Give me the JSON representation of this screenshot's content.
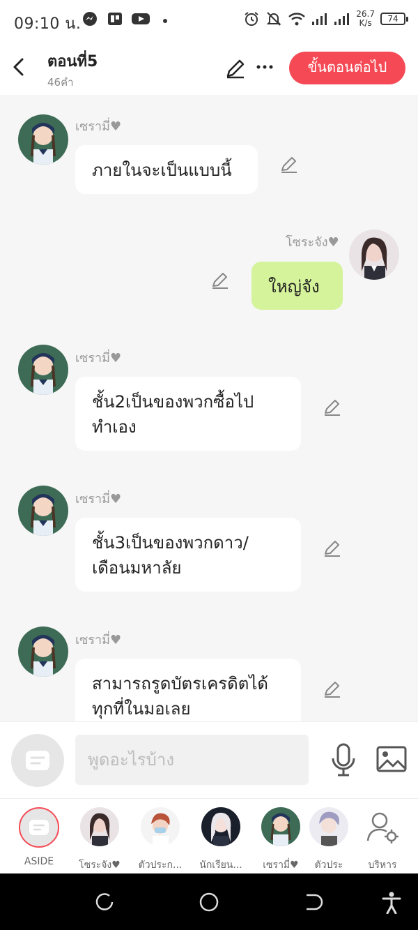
{
  "status_bar": {
    "time": "09:10 น.",
    "net_speed_value": "26.7",
    "net_speed_unit": "K/s",
    "battery": "74"
  },
  "header": {
    "title": "ตอนที่5",
    "word_count": "46คำ",
    "next_button": "ขั้นตอนต่อไป"
  },
  "messages": [
    {
      "sender": "เซรามี่♥",
      "text_lines": [
        "ภายในจะเป็นแบบนี้"
      ],
      "side": "left"
    },
    {
      "sender": "โซระจัง♥",
      "text_lines": [
        "ใหญ่จัง"
      ],
      "side": "right"
    },
    {
      "sender": "เซรามี่♥",
      "text_lines": [
        "ชั้น2เป็นของพวกซื้อไป",
        "ทำเอง"
      ],
      "side": "left"
    },
    {
      "sender": "เซรามี่♥",
      "text_lines": [
        "ชั้น3เป็นของพวกดาว/",
        "เดือนมหาลัย"
      ],
      "side": "left"
    },
    {
      "sender": "เซรามี่♥",
      "text_lines": [
        "สามารถรูดบัตรเครดิตได้",
        "ทุกที่ในมอเลย"
      ],
      "side": "left"
    }
  ],
  "input_bar": {
    "placeholder": "พูดอะไรบ้าง"
  },
  "characters": [
    {
      "label": "ASIDE"
    },
    {
      "label": "โซระจัง♥"
    },
    {
      "label": "ตัวประก..."
    },
    {
      "label": "นักเรียน..."
    },
    {
      "label": "เซรามี่♥"
    },
    {
      "label": "ตัวประ"
    },
    {
      "label": "บริหาร"
    }
  ],
  "colors": {
    "accent": "#f54a55",
    "right_bubble": "#d5f39a",
    "chat_background": "#f6f6f6"
  }
}
